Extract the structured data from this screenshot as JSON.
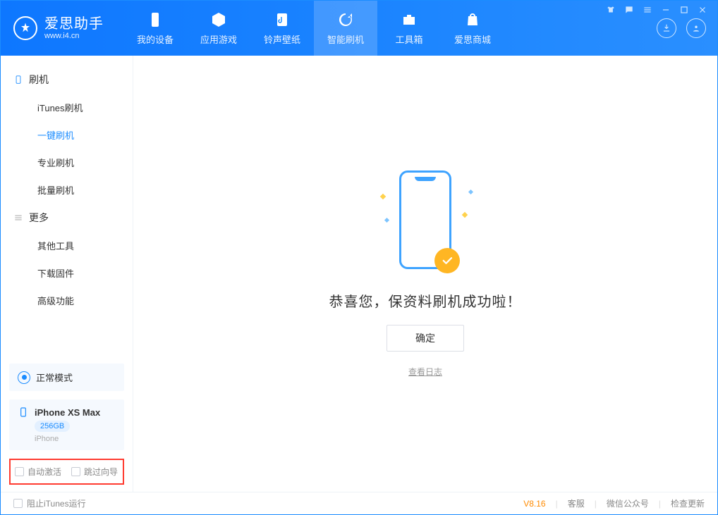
{
  "app": {
    "title": "爱思助手",
    "url": "www.i4.cn"
  },
  "tabs": {
    "device": "我的设备",
    "apps": "应用游戏",
    "ring": "铃声壁纸",
    "flash": "智能刷机",
    "tools": "工具箱",
    "store": "爱思商城"
  },
  "sidebar": {
    "group_flash": "刷机",
    "items_flash": {
      "itunes": "iTunes刷机",
      "onekey": "一键刷机",
      "pro": "专业刷机",
      "batch": "批量刷机"
    },
    "group_more": "更多",
    "items_more": {
      "other": "其他工具",
      "download": "下载固件",
      "advanced": "高级功能"
    },
    "mode": "正常模式",
    "device": {
      "name": "iPhone XS Max",
      "storage": "256GB",
      "type": "iPhone"
    },
    "highlight": {
      "auto_activate": "自动激活",
      "skip_guide": "跳过向导"
    }
  },
  "main": {
    "success_msg": "恭喜您，保资料刷机成功啦！",
    "ok_btn": "确定",
    "view_log": "查看日志"
  },
  "footer": {
    "block_itunes": "阻止iTunes运行",
    "version": "V8.16",
    "support": "客服",
    "wechat": "微信公众号",
    "update": "检查更新"
  }
}
